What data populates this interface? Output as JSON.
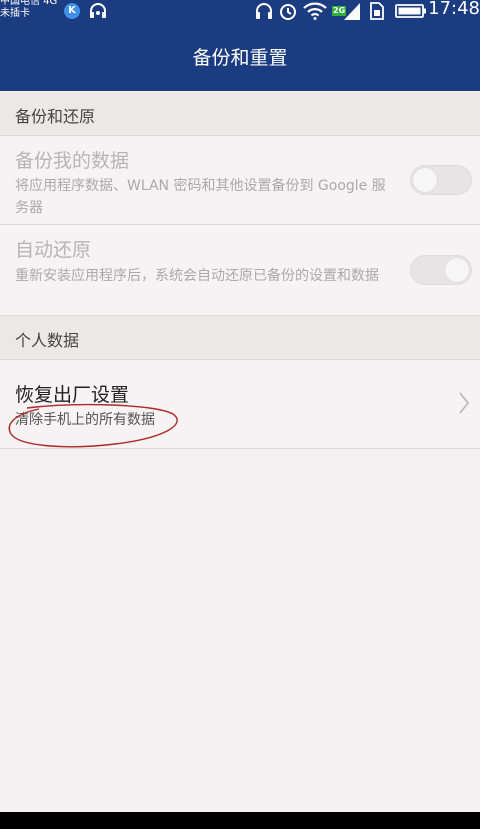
{
  "status_bar": {
    "carrier_line1": "中国电信 4G",
    "carrier_line2": "未插卡",
    "app_badge": "K",
    "network_badge": "2G",
    "time": "17:48",
    "icons": [
      "k-app-icon",
      "headset-assist-icon",
      "headphones-icon",
      "alarm-icon",
      "wifi-icon",
      "signal-icon",
      "sim-icon",
      "battery-icon"
    ]
  },
  "header": {
    "title": "备份和重置"
  },
  "sections": {
    "backup_restore": {
      "header": "备份和还原",
      "items": [
        {
          "title": "备份我的数据",
          "subtitle": "将应用程序数据、WLAN 密码和其他设置备份到 Google 服务器",
          "toggle": "off",
          "enabled": false
        },
        {
          "title": "自动还原",
          "subtitle": "重新安装应用程序后，系统会自动还原已备份的设置和数据",
          "toggle": "on",
          "enabled": false
        }
      ]
    },
    "personal_data": {
      "header": "个人数据",
      "items": [
        {
          "title": "恢复出厂设置",
          "subtitle": "清除手机上的所有数据"
        }
      ]
    }
  },
  "colors": {
    "header_bg": "#1c3c82",
    "page_bg": "#f3f1f1",
    "section_bg": "#ebe8e8",
    "annotation": "#b02828"
  }
}
